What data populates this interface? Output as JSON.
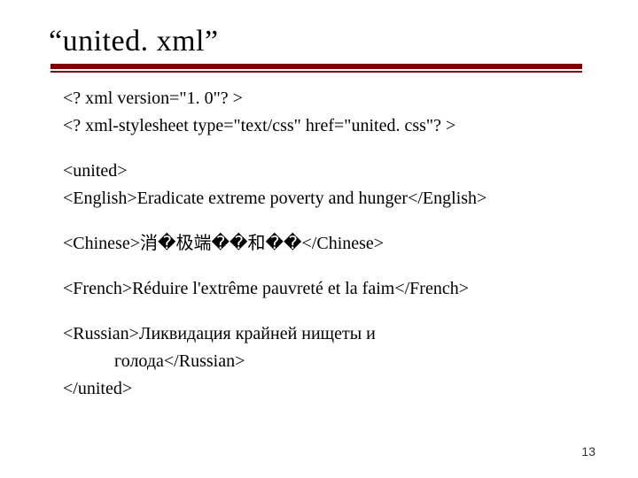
{
  "title": "“united. xml”",
  "lines": {
    "xml_decl": "<? xml version=\"1. 0\"? >",
    "stylesheet": "<? xml-stylesheet type=\"text/css\" href=\"united. css\"? >",
    "root_open": "<united>",
    "english": "<English>Eradicate extreme poverty and hunger</English>",
    "chinese": "<Chinese>消�极端��和��</Chinese>",
    "french": "<French>Réduire l'extrême pauvreté et la faim</French>",
    "russian_l1": "<Russian>Ликвидация крайней нищеты и",
    "russian_l2": "голода</Russian>",
    "root_close": "</united>"
  },
  "page_number": "13"
}
